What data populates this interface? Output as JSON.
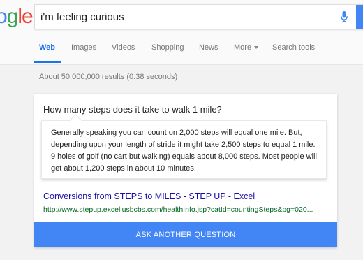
{
  "logo": {
    "text_blue": "o",
    "text_green": "g",
    "text_red": "le",
    "prefix_blue": ""
  },
  "search": {
    "query": "i'm feeling curious"
  },
  "tabs": [
    {
      "label": "Web",
      "active": true
    },
    {
      "label": "Images",
      "active": false
    },
    {
      "label": "Videos",
      "active": false
    },
    {
      "label": "Shopping",
      "active": false
    },
    {
      "label": "News",
      "active": false
    },
    {
      "label": "More",
      "active": false
    },
    {
      "label": "Search tools",
      "active": false
    }
  ],
  "results": {
    "stats": "About 50,000,000 results (0.38 seconds)"
  },
  "card": {
    "question": "How many steps does it take to walk 1 mile?",
    "answer": "Generally speaking you can count on 2,000 steps will equal one mile. But, depending upon your length of stride it might take 2,500 steps to equal 1 mile. 9 holes of golf (no cart but walking) equals about 8,000 steps. Most people will get about 1,200 steps in about 10 minutes.",
    "source_title": "Conversions from STEPS to MILES - STEP UP - Excel",
    "source_url": "http://www.stepup.excellusbcbs.com/healthInfo.jsp?catId=countingSteps&pg=020...",
    "ask_button": "ASK ANOTHER QUESTION"
  },
  "colors": {
    "google_blue": "#4285f4",
    "google_green": "#34a853",
    "google_red": "#ea4335",
    "link_blue": "#1a0dab",
    "url_green": "#006621",
    "active_tab": "#1a73e8"
  },
  "icons": {
    "mic": "microphone-icon",
    "more_caret": "caret-down-icon"
  }
}
